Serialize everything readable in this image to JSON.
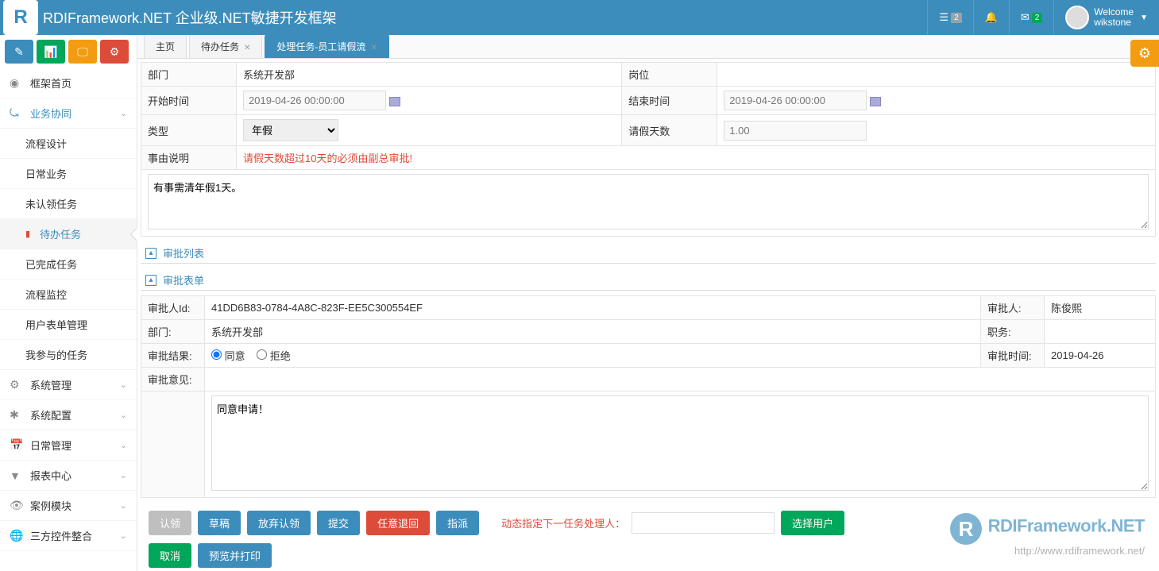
{
  "header": {
    "app_title": "RDIFramework.NET 企业级.NET敏捷开发框架",
    "logo_letter": "R",
    "list_badge": "2",
    "mail_badge": "2",
    "welcome": "Welcome",
    "username": "wikstone"
  },
  "sidebar": {
    "home": "框架首页",
    "biz_collab": "业务协同",
    "items": {
      "flow_design": "流程设计",
      "daily_biz": "日常业务",
      "unclaimed": "未认领任务",
      "pending": "待办任务",
      "completed": "已完成任务",
      "monitor": "流程监控",
      "user_form": "用户表单管理",
      "my_tasks": "我参与的任务"
    },
    "sys_mgmt": "系统管理",
    "sys_config": "系统配置",
    "daily_mgmt": "日常管理",
    "report": "报表中心",
    "examples": "案例模块",
    "third_party": "三方控件整合"
  },
  "tabs": {
    "home": "主页",
    "pending": "待办任务",
    "process": "处理任务-员工请假流"
  },
  "form": {
    "dept_label": "部门",
    "dept_value": "系统开发部",
    "position_label": "岗位",
    "start_label": "开始时间",
    "start_value": "2019-04-26 00:00:00",
    "end_label": "结束时间",
    "end_value": "2019-04-26 00:00:00",
    "type_label": "类型",
    "type_value": "年假",
    "days_label": "请假天数",
    "days_value": "1.00",
    "reason_label": "事由说明",
    "reason_warning": "请假天数超过10天的必须由副总审批!",
    "reason_text": "有事需清年假1天。"
  },
  "sections": {
    "approval_list": "审批列表",
    "approval_form": "审批表单"
  },
  "approval": {
    "approver_id_label": "审批人Id:",
    "approver_id": "41DD6B83-0784-4A8C-823F-EE5C300554EF",
    "approver_label": "审批人:",
    "approver": "陈俊熙",
    "dept_label": "部门:",
    "dept": "系统开发部",
    "position_label": "职务:",
    "result_label": "审批结果:",
    "agree": "同意",
    "reject": "拒绝",
    "time_label": "审批时间:",
    "time": "2019-04-26",
    "opinion_label": "审批意见:",
    "opinion_text": "同意申请！"
  },
  "actions": {
    "claim": "认领",
    "draft": "草稿",
    "abandon": "放弃认领",
    "submit": "提交",
    "reject_back": "任意退回",
    "delegate": "指派",
    "next_label": "动态指定下一任务处理人：",
    "select_user": "选择用户",
    "cancel": "取消",
    "preview_print": "预览并打印"
  },
  "watermark": {
    "title": "RDIFramework.NET",
    "url": "http://www.rdiframework.net/"
  }
}
